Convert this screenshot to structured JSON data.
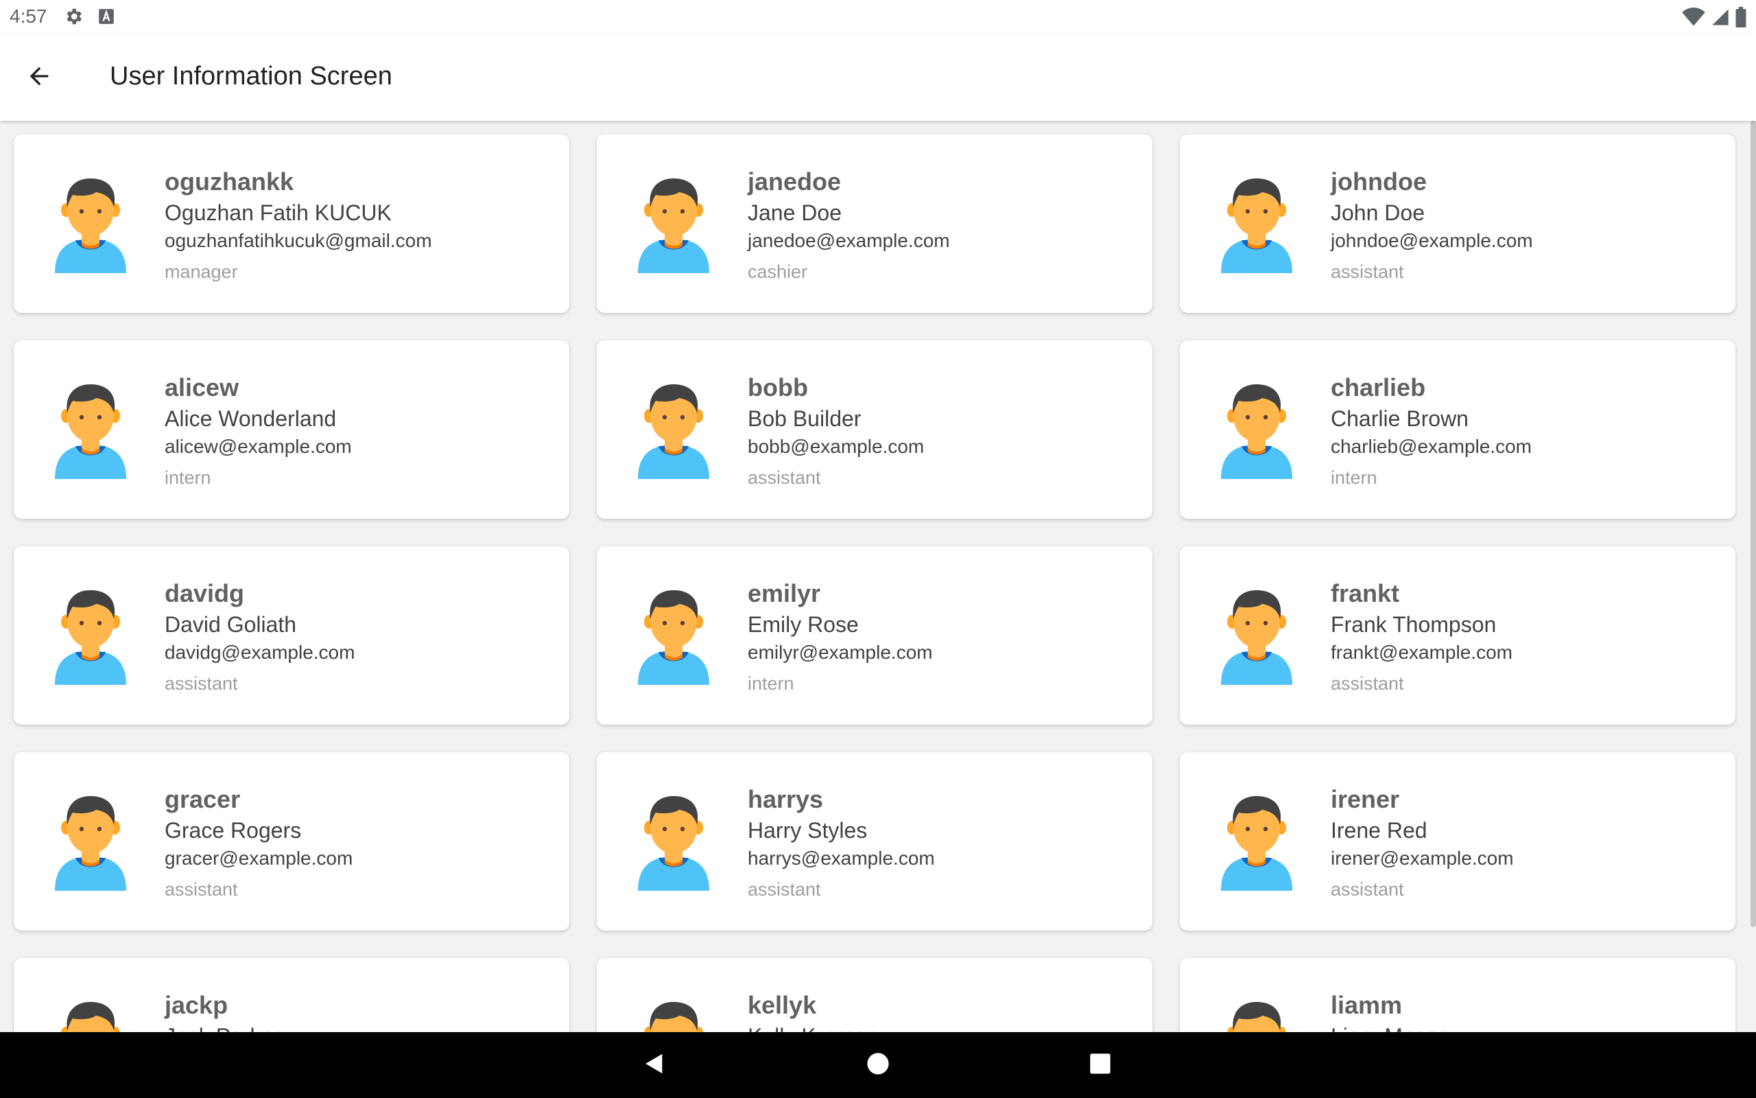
{
  "status_bar": {
    "time": "4:57",
    "left_icons": [
      "settings-gear-icon",
      "keyboard-a-icon"
    ],
    "right_icons": [
      "wifi-icon",
      "cell-signal-icon",
      "battery-icon"
    ]
  },
  "app_bar": {
    "back_icon": "arrow-back-icon",
    "title": "User Information Screen"
  },
  "users": [
    {
      "username": "oguzhankk",
      "name": "Oguzhan Fatih KUCUK",
      "email": "oguzhanfatihkucuk@gmail.com",
      "role": "manager"
    },
    {
      "username": "janedoe",
      "name": "Jane Doe",
      "email": "janedoe@example.com",
      "role": "cashier"
    },
    {
      "username": "johndoe",
      "name": "John Doe",
      "email": "johndoe@example.com",
      "role": "assistant"
    },
    {
      "username": "alicew",
      "name": "Alice Wonderland",
      "email": "alicew@example.com",
      "role": "intern"
    },
    {
      "username": "bobb",
      "name": "Bob Builder",
      "email": "bobb@example.com",
      "role": "assistant"
    },
    {
      "username": "charlieb",
      "name": "Charlie Brown",
      "email": "charlieb@example.com",
      "role": "intern"
    },
    {
      "username": "davidg",
      "name": "David Goliath",
      "email": "davidg@example.com",
      "role": "assistant"
    },
    {
      "username": "emilyr",
      "name": "Emily Rose",
      "email": "emilyr@example.com",
      "role": "intern"
    },
    {
      "username": "frankt",
      "name": "Frank Thompson",
      "email": "frankt@example.com",
      "role": "assistant"
    },
    {
      "username": "gracer",
      "name": "Grace Rogers",
      "email": "gracer@example.com",
      "role": "assistant"
    },
    {
      "username": "harrys",
      "name": "Harry Styles",
      "email": "harrys@example.com",
      "role": "assistant"
    },
    {
      "username": "irener",
      "name": "Irene Red",
      "email": "irener@example.com",
      "role": "assistant"
    },
    {
      "username": "jackp",
      "name": "Jack Parker",
      "email": "",
      "role": ""
    },
    {
      "username": "kellyk",
      "name": "Kelly Kramer",
      "email": "",
      "role": ""
    },
    {
      "username": "liamm",
      "name": "Liam Mason",
      "email": "",
      "role": ""
    }
  ],
  "colors": {
    "avatar_skin": "#FFB74D",
    "avatar_hair": "#424242",
    "avatar_shirt": "#4FC3F7",
    "avatar_collar": "#1565C0"
  },
  "nav_bar": {
    "icons": [
      "back-triangle-icon",
      "home-circle-icon",
      "recents-square-icon"
    ]
  }
}
